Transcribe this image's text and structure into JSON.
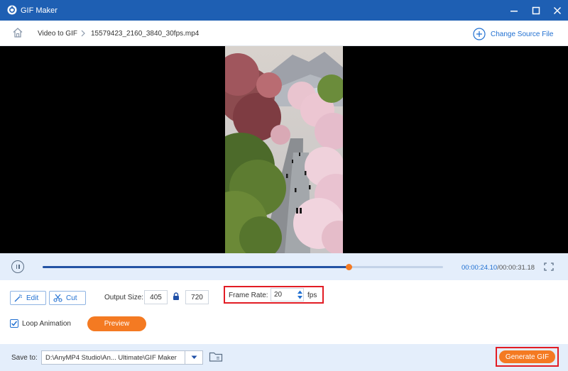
{
  "window": {
    "title": "GIF Maker"
  },
  "nav": {
    "crumb_root": "Video to GIF",
    "crumb_file": "15579423_2160_3840_30fps.mp4",
    "change_source": "Change Source File"
  },
  "playback": {
    "current_time": "00:00:24.10",
    "separator": "/",
    "total_time": "00:00:31.18",
    "progress": 0.765
  },
  "settings": {
    "edit_label": "Edit",
    "cut_label": "Cut",
    "output_size_label": "Output Size:",
    "width": "405",
    "height": "720",
    "frame_rate_label": "Frame Rate:",
    "frame_rate": "20",
    "frame_rate_unit": "fps",
    "loop_label": "Loop Animation",
    "loop_checked": true,
    "preview_label": "Preview"
  },
  "footer": {
    "save_to_label": "Save to:",
    "save_path": "D:\\AnyMP4 Studio\\An... Ultimate\\GIF Maker",
    "generate_label": "Generate GIF"
  },
  "colors": {
    "titlebar": "#1e5fb3",
    "accent": "#1f6fd1",
    "orange": "#f47a22",
    "highlight": "#e21c24",
    "panel": "#e4eefb"
  }
}
